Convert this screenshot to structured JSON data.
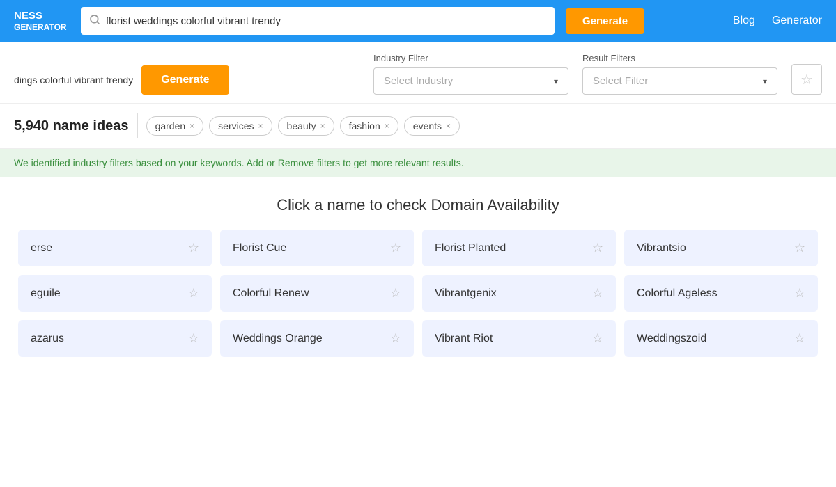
{
  "header": {
    "logo_line1": "NESS",
    "logo_line2": "GENERATOR",
    "search_value": "florist weddings colorful vibrant trendy",
    "search_placeholder": "florist weddings colorful vibrant trendy",
    "generate_label": "Generate",
    "nav_links": [
      "Blog",
      "Generator"
    ]
  },
  "filters": {
    "industry_filter_label": "Industry Filter",
    "industry_placeholder": "Select Industry",
    "result_filter_label": "Result Filters",
    "result_placeholder": "Select Filter",
    "generate_label": "Generate",
    "search_preview": "dings colorful vibrant trendy",
    "save_icon": "☆"
  },
  "results": {
    "count": "5,940 name ideas",
    "tags": [
      {
        "label": "garden",
        "x": "×"
      },
      {
        "label": "services",
        "x": "×"
      },
      {
        "label": "beauty",
        "x": "×"
      },
      {
        "label": "fashion",
        "x": "×"
      },
      {
        "label": "events",
        "x": "×"
      }
    ]
  },
  "info_banner": {
    "text": "We identified industry filters based on your keywords. Add or Remove filters to get more relevant results."
  },
  "domain_section": {
    "title": "Click a name to check Domain Availability"
  },
  "names": [
    {
      "text": "erse"
    },
    {
      "text": "Florist Cue"
    },
    {
      "text": "Florist Planted"
    },
    {
      "text": "Vibrantsio"
    },
    {
      "text": "eguile"
    },
    {
      "text": "Colorful Renew"
    },
    {
      "text": "Vibrantgenix"
    },
    {
      "text": "Colorful Ageless"
    },
    {
      "text": "azarus"
    },
    {
      "text": "Weddings Orange"
    },
    {
      "text": "Vibrant Riot"
    },
    {
      "text": "Weddingszoid"
    }
  ]
}
